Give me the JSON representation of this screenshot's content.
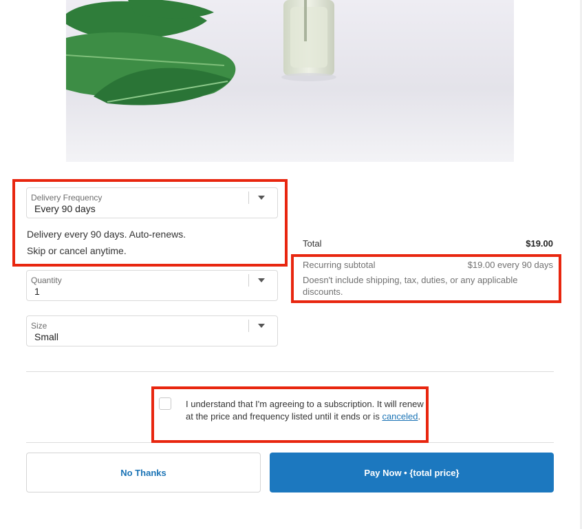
{
  "delivery_frequency": {
    "label": "Delivery Frequency",
    "value": "Every 90 days",
    "description_line1": "Delivery every 90 days. Auto-renews.",
    "description_line2": "Skip or cancel anytime."
  },
  "quantity": {
    "label": "Quantity",
    "value": "1"
  },
  "size": {
    "label": "Size",
    "value": "Small"
  },
  "summary": {
    "total_label": "Total",
    "total_value": "$19.00",
    "recurring_label": "Recurring subtotal",
    "recurring_value": "$19.00 every 90 days",
    "recurring_note": "Doesn't include shipping, tax, duties, or any applicable discounts."
  },
  "consent": {
    "text": "I understand that I'm agreeing to a subscription. It will renew at the price and frequency listed until it ends or is ",
    "link_text": "canceled",
    "suffix": ".",
    "checked": false
  },
  "buttons": {
    "secondary_label": "No Thanks",
    "primary_label": "Pay Now • {total price}"
  },
  "colors": {
    "primary_button": "#1c78bf",
    "link": "#1a73b5",
    "annotation": "#e8260f"
  },
  "icons": [
    "dropdown-caret-icon",
    "checkbox-icon"
  ]
}
